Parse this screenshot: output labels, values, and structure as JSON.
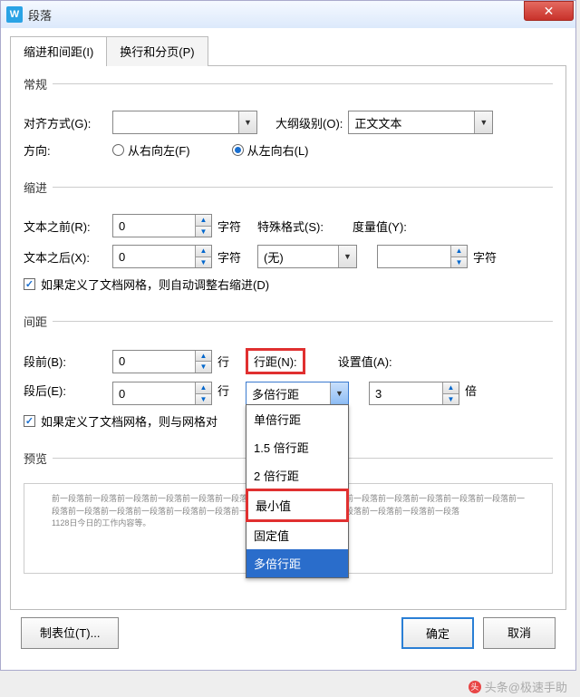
{
  "title": "段落",
  "tabs": [
    "缩进和间距(I)",
    "换行和分页(P)"
  ],
  "sections": {
    "general": {
      "legend": "常规",
      "align_label": "对齐方式(G):",
      "align_value": "",
      "outline_label": "大纲级别(O):",
      "outline_value": "正文文本",
      "direction_label": "方向:",
      "rtl": "从右向左(F)",
      "ltr": "从左向右(L)"
    },
    "indent": {
      "legend": "缩进",
      "before_label": "文本之前(R):",
      "before_value": "0",
      "unit_char": "字符",
      "special_label": "特殊格式(S):",
      "special_value": "(无)",
      "measure_label": "度量值(Y):",
      "after_label": "文本之后(X):",
      "after_value": "0",
      "grid_check": "如果定义了文档网格，则自动调整右缩进(D)"
    },
    "spacing": {
      "legend": "间距",
      "before_label": "段前(B):",
      "before_value": "0",
      "unit_line": "行",
      "linespace_label": "行距(N):",
      "setvalue_label": "设置值(A):",
      "after_label": "段后(E):",
      "after_value": "0",
      "linespace_value": "多倍行距",
      "setvalue_value": "3",
      "unit_times": "倍",
      "options": [
        "单倍行距",
        "1.5 倍行距",
        "2 倍行距",
        "最小值",
        "固定值",
        "多倍行距"
      ],
      "grid_check": "如果定义了文档网格，则与网格对"
    },
    "preview": {
      "legend": "预览",
      "text": "前一段落前一段落前一段落前一段落前一段落前一段落前一段落前一段落前一段落前一段落前一段落前一段落前一段落前一段落前一段落前一段落前一段落前一段落前一段落前一段落前一段落前一段落前一段落前一段落前一段落前一段落前一段落\n1128日今日的工作内容等。"
    }
  },
  "footer": {
    "tabstops": "制表位(T)...",
    "ok": "确定",
    "cancel": "取消"
  },
  "watermark": "头条@极速手助"
}
